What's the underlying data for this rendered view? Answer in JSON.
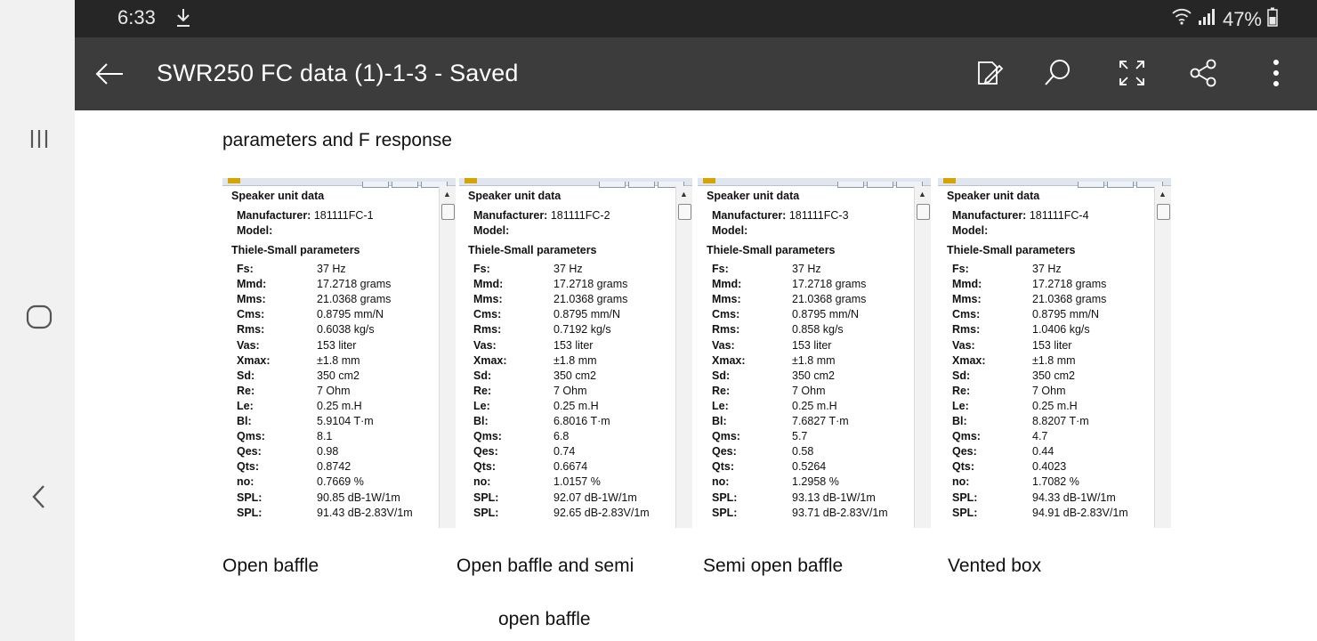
{
  "status_bar": {
    "time": "6:33",
    "battery": "47%"
  },
  "app_bar": {
    "title": "SWR250 FC data (1)-1-3 - Saved"
  },
  "document": {
    "heading": "parameters and F response",
    "panels": [
      {
        "section1": "Speaker unit data",
        "manufacturer_label": "Manufacturer:",
        "manufacturer_value": "181111FC-1",
        "model_label": "Model:",
        "section2": "Thiele-Small parameters",
        "params": [
          {
            "k": "Fs:",
            "v": "37 Hz"
          },
          {
            "k": "Mmd:",
            "v": "17.2718 grams"
          },
          {
            "k": "Mms:",
            "v": "21.0368 grams"
          },
          {
            "k": "Cms:",
            "v": "0.8795 mm/N"
          },
          {
            "k": "Rms:",
            "v": "0.6038 kg/s"
          },
          {
            "k": "Vas:",
            "v": "153 liter"
          },
          {
            "k": "Xmax:",
            "v": "±1.8 mm"
          },
          {
            "k": "Sd:",
            "v": "350 cm2"
          },
          {
            "k": "Re:",
            "v": "7 Ohm"
          },
          {
            "k": "Le:",
            "v": "0.25 m.H"
          },
          {
            "k": "Bl:",
            "v": "5.9104 T·m"
          },
          {
            "k": "Qms:",
            "v": "8.1"
          },
          {
            "k": "Qes:",
            "v": "0.98"
          },
          {
            "k": "Qts:",
            "v": "0.8742"
          },
          {
            "k": "no:",
            "v": "0.7669 %"
          },
          {
            "k": "SPL:",
            "v": "90.85 dB-1W/1m"
          },
          {
            "k": "SPL:",
            "v": "91.43 dB-2.83V/1m"
          }
        ],
        "caption": "Open baffle",
        "caption2": ""
      },
      {
        "section1": "Speaker unit data",
        "manufacturer_label": "Manufacturer:",
        "manufacturer_value": "181111FC-2",
        "model_label": "Model:",
        "section2": "Thiele-Small parameters",
        "params": [
          {
            "k": "Fs:",
            "v": "37 Hz"
          },
          {
            "k": "Mmd:",
            "v": "17.2718 grams"
          },
          {
            "k": "Mms:",
            "v": "21.0368 grams"
          },
          {
            "k": "Cms:",
            "v": "0.8795 mm/N"
          },
          {
            "k": "Rms:",
            "v": "0.7192 kg/s"
          },
          {
            "k": "Vas:",
            "v": "153 liter"
          },
          {
            "k": "Xmax:",
            "v": "±1.8 mm"
          },
          {
            "k": "Sd:",
            "v": "350 cm2"
          },
          {
            "k": "Re:",
            "v": "7 Ohm"
          },
          {
            "k": "Le:",
            "v": "0.25 m.H"
          },
          {
            "k": "Bl:",
            "v": "6.8016 T·m"
          },
          {
            "k": "Qms:",
            "v": "6.8"
          },
          {
            "k": "Qes:",
            "v": "0.74"
          },
          {
            "k": "Qts:",
            "v": "0.6674"
          },
          {
            "k": "no:",
            "v": "1.0157 %"
          },
          {
            "k": "SPL:",
            "v": "92.07 dB-1W/1m"
          },
          {
            "k": "SPL:",
            "v": "92.65 dB-2.83V/1m"
          }
        ],
        "caption": "Open baffle and semi",
        "caption2": "open baffle"
      },
      {
        "section1": "Speaker unit data",
        "manufacturer_label": "Manufacturer:",
        "manufacturer_value": "181111FC-3",
        "model_label": "Model:",
        "section2": "Thiele-Small parameters",
        "params": [
          {
            "k": "Fs:",
            "v": "37 Hz"
          },
          {
            "k": "Mmd:",
            "v": "17.2718 grams"
          },
          {
            "k": "Mms:",
            "v": "21.0368 grams"
          },
          {
            "k": "Cms:",
            "v": "0.8795 mm/N"
          },
          {
            "k": "Rms:",
            "v": "0.858 kg/s"
          },
          {
            "k": "Vas:",
            "v": "153 liter"
          },
          {
            "k": "Xmax:",
            "v": "±1.8 mm"
          },
          {
            "k": "Sd:",
            "v": "350 cm2"
          },
          {
            "k": "Re:",
            "v": "7 Ohm"
          },
          {
            "k": "Le:",
            "v": "0.25 m.H"
          },
          {
            "k": "Bl:",
            "v": "7.6827 T·m"
          },
          {
            "k": "Qms:",
            "v": "5.7"
          },
          {
            "k": "Qes:",
            "v": "0.58"
          },
          {
            "k": "Qts:",
            "v": "0.5264"
          },
          {
            "k": "no:",
            "v": "1.2958 %"
          },
          {
            "k": "SPL:",
            "v": "93.13 dB-1W/1m"
          },
          {
            "k": "SPL:",
            "v": "93.71 dB-2.83V/1m"
          }
        ],
        "caption": "Semi open baffle",
        "caption2": ""
      },
      {
        "section1": "Speaker unit data",
        "manufacturer_label": "Manufacturer:",
        "manufacturer_value": "181111FC-4",
        "model_label": "Model:",
        "section2": "Thiele-Small parameters",
        "params": [
          {
            "k": "Fs:",
            "v": "37 Hz"
          },
          {
            "k": "Mmd:",
            "v": "17.2718 grams"
          },
          {
            "k": "Mms:",
            "v": "21.0368 grams"
          },
          {
            "k": "Cms:",
            "v": "0.8795 mm/N"
          },
          {
            "k": "Rms:",
            "v": "1.0406 kg/s"
          },
          {
            "k": "Vas:",
            "v": "153 liter"
          },
          {
            "k": "Xmax:",
            "v": "±1.8 mm"
          },
          {
            "k": "Sd:",
            "v": "350 cm2"
          },
          {
            "k": "Re:",
            "v": "7 Ohm"
          },
          {
            "k": "Le:",
            "v": "0.25 m.H"
          },
          {
            "k": "Bl:",
            "v": "8.8207 T·m"
          },
          {
            "k": "Qms:",
            "v": "4.7"
          },
          {
            "k": "Qes:",
            "v": "0.44"
          },
          {
            "k": "Qts:",
            "v": "0.4023"
          },
          {
            "k": "no:",
            "v": "1.7082 %"
          },
          {
            "k": "SPL:",
            "v": "94.33 dB-1W/1m"
          },
          {
            "k": "SPL:",
            "v": "94.91 dB-2.83V/1m"
          }
        ],
        "caption": "Vented box",
        "caption2": ""
      }
    ]
  },
  "icons": {
    "nav": [
      "recent-apps-icon",
      "home-icon",
      "back-nav-icon"
    ],
    "toolbar": [
      "edit-icon",
      "search-icon",
      "fullscreen-icon",
      "share-icon",
      "more-options-icon"
    ]
  },
  "colors": {
    "status_bar": "#262626",
    "app_bar": "#3c3c3c",
    "nav_bar": "#f1f1f1"
  }
}
